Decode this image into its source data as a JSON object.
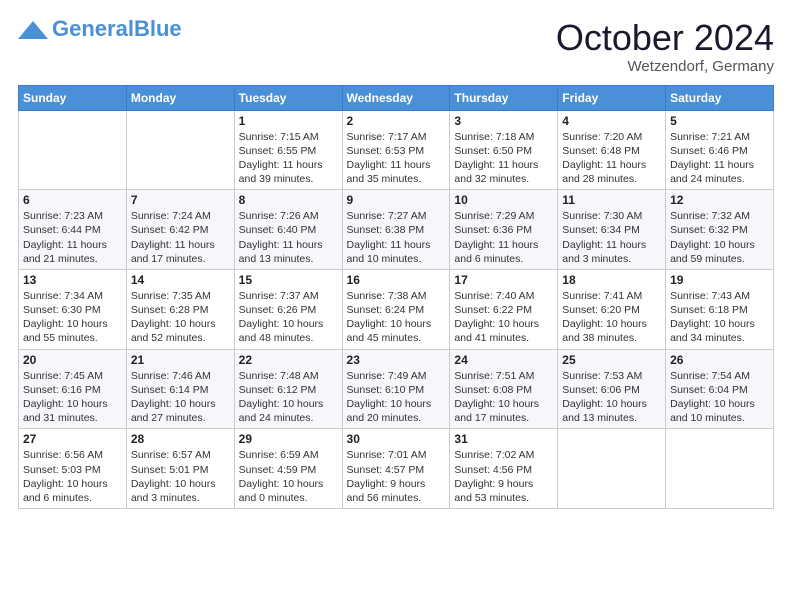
{
  "header": {
    "logo_general": "General",
    "logo_blue": "Blue",
    "month": "October 2024",
    "location": "Wetzendorf, Germany"
  },
  "weekdays": [
    "Sunday",
    "Monday",
    "Tuesday",
    "Wednesday",
    "Thursday",
    "Friday",
    "Saturday"
  ],
  "weeks": [
    [
      {
        "day": "",
        "info": ""
      },
      {
        "day": "",
        "info": ""
      },
      {
        "day": "1",
        "info": "Sunrise: 7:15 AM\nSunset: 6:55 PM\nDaylight: 11 hours and 39 minutes."
      },
      {
        "day": "2",
        "info": "Sunrise: 7:17 AM\nSunset: 6:53 PM\nDaylight: 11 hours and 35 minutes."
      },
      {
        "day": "3",
        "info": "Sunrise: 7:18 AM\nSunset: 6:50 PM\nDaylight: 11 hours and 32 minutes."
      },
      {
        "day": "4",
        "info": "Sunrise: 7:20 AM\nSunset: 6:48 PM\nDaylight: 11 hours and 28 minutes."
      },
      {
        "day": "5",
        "info": "Sunrise: 7:21 AM\nSunset: 6:46 PM\nDaylight: 11 hours and 24 minutes."
      }
    ],
    [
      {
        "day": "6",
        "info": "Sunrise: 7:23 AM\nSunset: 6:44 PM\nDaylight: 11 hours and 21 minutes."
      },
      {
        "day": "7",
        "info": "Sunrise: 7:24 AM\nSunset: 6:42 PM\nDaylight: 11 hours and 17 minutes."
      },
      {
        "day": "8",
        "info": "Sunrise: 7:26 AM\nSunset: 6:40 PM\nDaylight: 11 hours and 13 minutes."
      },
      {
        "day": "9",
        "info": "Sunrise: 7:27 AM\nSunset: 6:38 PM\nDaylight: 11 hours and 10 minutes."
      },
      {
        "day": "10",
        "info": "Sunrise: 7:29 AM\nSunset: 6:36 PM\nDaylight: 11 hours and 6 minutes."
      },
      {
        "day": "11",
        "info": "Sunrise: 7:30 AM\nSunset: 6:34 PM\nDaylight: 11 hours and 3 minutes."
      },
      {
        "day": "12",
        "info": "Sunrise: 7:32 AM\nSunset: 6:32 PM\nDaylight: 10 hours and 59 minutes."
      }
    ],
    [
      {
        "day": "13",
        "info": "Sunrise: 7:34 AM\nSunset: 6:30 PM\nDaylight: 10 hours and 55 minutes."
      },
      {
        "day": "14",
        "info": "Sunrise: 7:35 AM\nSunset: 6:28 PM\nDaylight: 10 hours and 52 minutes."
      },
      {
        "day": "15",
        "info": "Sunrise: 7:37 AM\nSunset: 6:26 PM\nDaylight: 10 hours and 48 minutes."
      },
      {
        "day": "16",
        "info": "Sunrise: 7:38 AM\nSunset: 6:24 PM\nDaylight: 10 hours and 45 minutes."
      },
      {
        "day": "17",
        "info": "Sunrise: 7:40 AM\nSunset: 6:22 PM\nDaylight: 10 hours and 41 minutes."
      },
      {
        "day": "18",
        "info": "Sunrise: 7:41 AM\nSunset: 6:20 PM\nDaylight: 10 hours and 38 minutes."
      },
      {
        "day": "19",
        "info": "Sunrise: 7:43 AM\nSunset: 6:18 PM\nDaylight: 10 hours and 34 minutes."
      }
    ],
    [
      {
        "day": "20",
        "info": "Sunrise: 7:45 AM\nSunset: 6:16 PM\nDaylight: 10 hours and 31 minutes."
      },
      {
        "day": "21",
        "info": "Sunrise: 7:46 AM\nSunset: 6:14 PM\nDaylight: 10 hours and 27 minutes."
      },
      {
        "day": "22",
        "info": "Sunrise: 7:48 AM\nSunset: 6:12 PM\nDaylight: 10 hours and 24 minutes."
      },
      {
        "day": "23",
        "info": "Sunrise: 7:49 AM\nSunset: 6:10 PM\nDaylight: 10 hours and 20 minutes."
      },
      {
        "day": "24",
        "info": "Sunrise: 7:51 AM\nSunset: 6:08 PM\nDaylight: 10 hours and 17 minutes."
      },
      {
        "day": "25",
        "info": "Sunrise: 7:53 AM\nSunset: 6:06 PM\nDaylight: 10 hours and 13 minutes."
      },
      {
        "day": "26",
        "info": "Sunrise: 7:54 AM\nSunset: 6:04 PM\nDaylight: 10 hours and 10 minutes."
      }
    ],
    [
      {
        "day": "27",
        "info": "Sunrise: 6:56 AM\nSunset: 5:03 PM\nDaylight: 10 hours and 6 minutes."
      },
      {
        "day": "28",
        "info": "Sunrise: 6:57 AM\nSunset: 5:01 PM\nDaylight: 10 hours and 3 minutes."
      },
      {
        "day": "29",
        "info": "Sunrise: 6:59 AM\nSunset: 4:59 PM\nDaylight: 10 hours and 0 minutes."
      },
      {
        "day": "30",
        "info": "Sunrise: 7:01 AM\nSunset: 4:57 PM\nDaylight: 9 hours and 56 minutes."
      },
      {
        "day": "31",
        "info": "Sunrise: 7:02 AM\nSunset: 4:56 PM\nDaylight: 9 hours and 53 minutes."
      },
      {
        "day": "",
        "info": ""
      },
      {
        "day": "",
        "info": ""
      }
    ]
  ]
}
